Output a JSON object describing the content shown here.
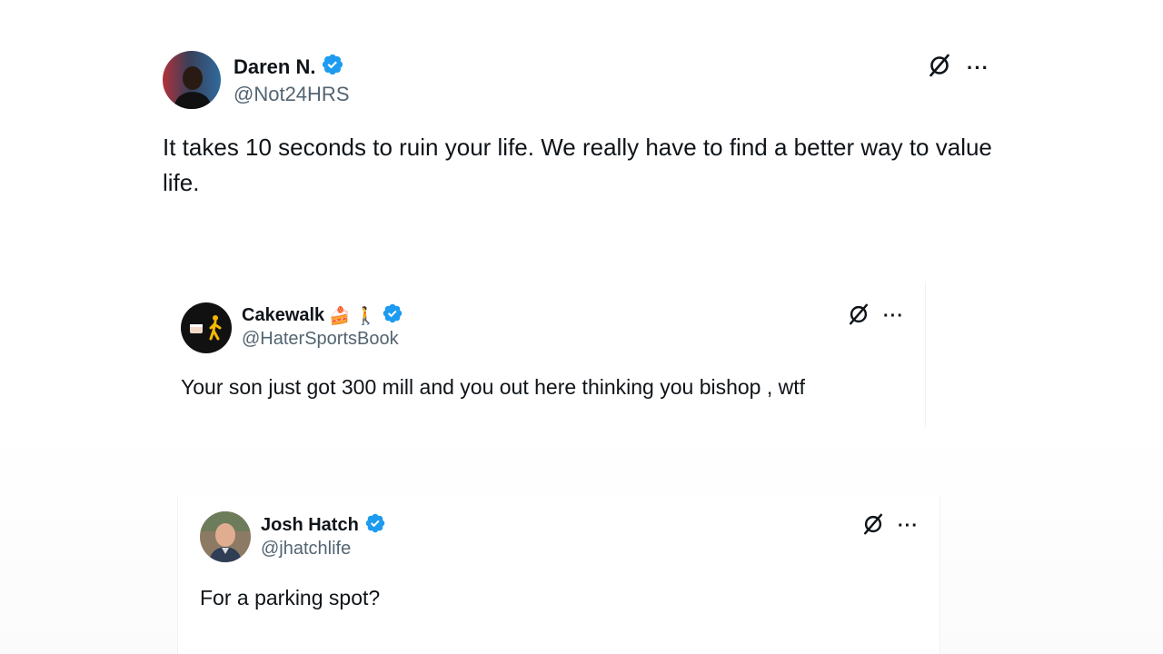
{
  "posts": [
    {
      "name": "Daren N.",
      "handle": "@Not24HRS",
      "verified": true,
      "text": "It takes 10 seconds to ruin your life. We really have to find a better way to value life.",
      "actions": {
        "grok_icon": "grok-icon",
        "more_label": "···"
      }
    },
    {
      "name": "Cakewalk",
      "name_emojis": [
        "🍰",
        "🚶"
      ],
      "handle": "@HaterSportsBook",
      "verified": true,
      "text": "Your son just got 300 mill and you out here thinking you bishop , wtf",
      "actions": {
        "grok_icon": "grok-icon",
        "more_label": "···"
      }
    },
    {
      "name": "Josh Hatch",
      "handle": "@jhatchlife",
      "verified": true,
      "text": "For a parking spot?",
      "actions": {
        "grok_icon": "grok-icon",
        "more_label": "···"
      }
    }
  ],
  "colors": {
    "verified": "#1d9bf0",
    "text": "#0f1419",
    "handle": "#536471"
  }
}
